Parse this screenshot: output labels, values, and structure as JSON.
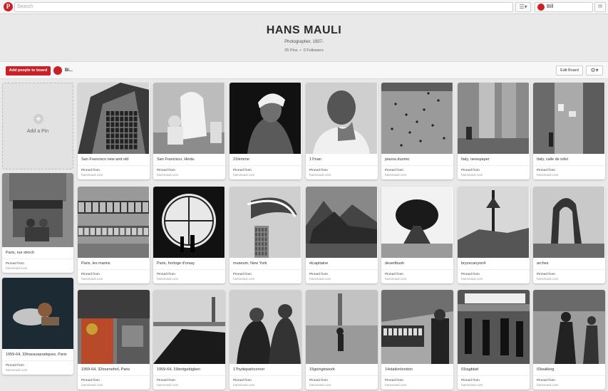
{
  "header": {
    "logo_letter": "P",
    "search_placeholder": "Search",
    "menu_icon": "hamburger-icon",
    "user_name": "Bill",
    "messages_icon": "message-icon"
  },
  "board": {
    "title": "HANS MAULI",
    "description": "Photographer, 1937-",
    "pins": "25 Pins",
    "separator": "•",
    "followers": "0 Followers"
  },
  "actions": {
    "add_people": "Add people to board",
    "collaborator": "Bi...",
    "edit_board": "Edit Board",
    "settings_icon": "gear-icon"
  },
  "add_pin": {
    "label": "Add a Pin",
    "icon": "plus-icon"
  },
  "pin_common": {
    "pinned_from": "Pinned from",
    "source": "hansmauli.com"
  },
  "colors": {
    "brand": "#cb2027"
  },
  "pins": [
    {
      "desc": "San Francisco new and old",
      "image": "photo-san-francisco-skyscraper"
    },
    {
      "desc": "San Francisco, Hindu",
      "image": "photo-seated-figures"
    },
    {
      "desc": "21femme",
      "image": "photo-woman-headwrap"
    },
    {
      "desc": "17man",
      "image": "photo-man-hand-on-chin"
    },
    {
      "desc": "piazza duomo",
      "image": "photo-piazza-aerial"
    },
    {
      "desc": "Italy, newspaper",
      "image": "photo-columns-reader"
    },
    {
      "desc": "Italy, calle de iolivi",
      "image": "photo-street-laundry"
    },
    {
      "desc": "Paris, rue stroch",
      "image": "photo-paris-storefront"
    },
    {
      "desc": "Paris, les marins",
      "image": "photo-train-windows"
    },
    {
      "desc": "Paris, horloge d'orsay",
      "image": "photo-orsay-clock"
    },
    {
      "desc": "museum, New York",
      "image": "photo-museum-architecture"
    },
    {
      "desc": "elcapitaine",
      "image": "photo-el-capitan"
    },
    {
      "desc": "desertbush",
      "image": "photo-desert-bush"
    },
    {
      "desc": "brycecanyon4",
      "image": "photo-bryce-canyon-tree"
    },
    {
      "desc": "arches",
      "image": "photo-delicate-arch"
    },
    {
      "desc": "1959-64, 33travauxpratiques, Paris",
      "image": "photo-reclining-couple"
    },
    {
      "desc": "1959-64, 32tourneforl, Paris",
      "image": "photo-cafe-facade"
    },
    {
      "desc": "1959-64, 19bridgebigben",
      "image": "photo-bridge-big-ben"
    },
    {
      "desc": "17hydeparkcorner",
      "image": "photo-men-hyde-park"
    },
    {
      "desc": "15goingtowork",
      "image": "photo-going-to-work"
    },
    {
      "desc": "14stationlondon",
      "image": "photo-london-station"
    },
    {
      "desc": "01tagblatt",
      "image": "photo-tagblatt-sign"
    },
    {
      "desc": "03walking",
      "image": "photo-walking-street"
    }
  ]
}
